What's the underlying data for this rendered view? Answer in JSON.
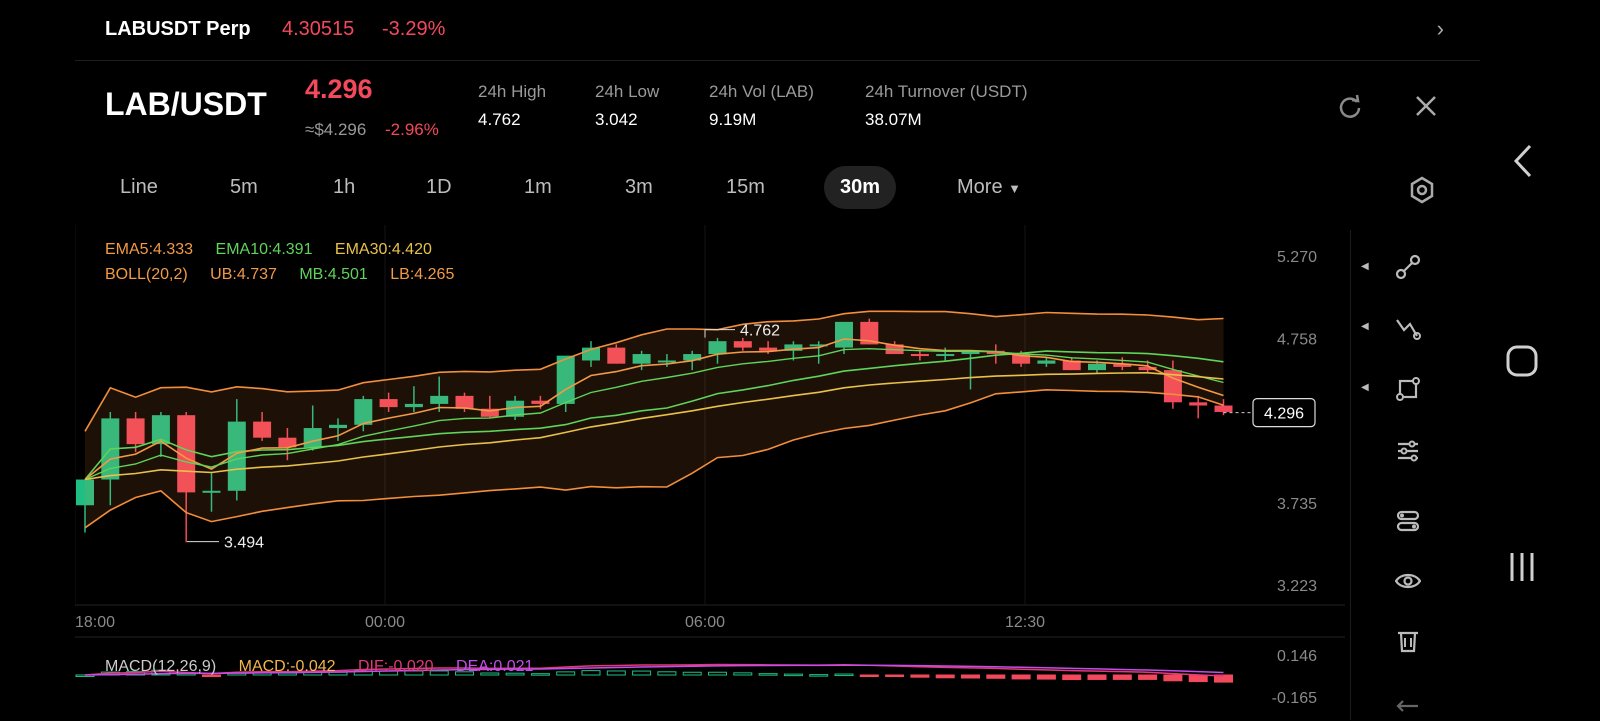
{
  "perp": {
    "name": "LABUSDT Perp",
    "price": "4.30515",
    "change": "-3.29%"
  },
  "header": {
    "pair": "LAB/USDT",
    "last_price": "4.296",
    "approx": "≈$4.296",
    "change": "-2.96%",
    "stats": [
      {
        "label": "24h  High",
        "value": "4.762"
      },
      {
        "label": "24h  Low",
        "value": "3.042"
      },
      {
        "label": "24h  Vol (LAB)",
        "value": "9.19M"
      },
      {
        "label": "24h  Turnover (USDT)",
        "value": "38.07M"
      }
    ]
  },
  "tabs": [
    "Line",
    "5m",
    "1h",
    "1D",
    "1m",
    "3m",
    "15m",
    "30m"
  ],
  "active_tab": "30m",
  "more_label": "More",
  "indicators": {
    "ema5": "EMA5:4.333",
    "ema10": "EMA10:4.391",
    "ema30": "EMA30:4.420",
    "boll": "BOLL(20,2)",
    "ub": "UB:4.737",
    "mb": "MB:4.501",
    "lb": "LB:4.265",
    "macd_name": "MACD(12,26,9)",
    "macd": "MACD:-0.042",
    "dif": "DIF:-0.020",
    "dea": "DEA:0.021"
  },
  "colors": {
    "up": "#1fbf83",
    "down": "#f2495c",
    "ema5": "#f29a45",
    "ema10": "#5fd35a",
    "ema30": "#e8c14a",
    "boll": "#f28e3c",
    "dea": "#c44ee8",
    "dif": "#e03a7a"
  },
  "chart_data": {
    "type": "candlestick",
    "y_ticks": [
      "5.270",
      "4.758",
      "3.735",
      "3.223"
    ],
    "x_ticks": [
      "18:00",
      "00:00",
      "06:00",
      "12:30"
    ],
    "current_price": "4.296",
    "high_marker": "4.762",
    "low_marker": "3.494",
    "macd_ticks": [
      "0.146",
      "-0.165"
    ],
    "ylim": [
      3.223,
      5.27
    ],
    "candles": [
      {
        "o": 3.72,
        "h": 3.84,
        "l": 3.55,
        "c": 3.88
      },
      {
        "o": 3.88,
        "h": 4.3,
        "l": 3.72,
        "c": 4.26
      },
      {
        "o": 4.26,
        "h": 4.3,
        "l": 4.05,
        "c": 4.1
      },
      {
        "o": 4.1,
        "h": 4.3,
        "l": 4.02,
        "c": 4.28
      },
      {
        "o": 4.28,
        "h": 4.3,
        "l": 3.49,
        "c": 3.8
      },
      {
        "o": 3.8,
        "h": 3.92,
        "l": 3.68,
        "c": 3.81
      },
      {
        "o": 3.81,
        "h": 4.38,
        "l": 3.75,
        "c": 4.24
      },
      {
        "o": 4.24,
        "h": 4.3,
        "l": 4.12,
        "c": 4.14
      },
      {
        "o": 4.14,
        "h": 4.2,
        "l": 4.0,
        "c": 4.08
      },
      {
        "o": 4.08,
        "h": 4.34,
        "l": 4.06,
        "c": 4.2
      },
      {
        "o": 4.2,
        "h": 4.26,
        "l": 4.12,
        "c": 4.22
      },
      {
        "o": 4.22,
        "h": 4.4,
        "l": 4.18,
        "c": 4.38
      },
      {
        "o": 4.38,
        "h": 4.42,
        "l": 4.3,
        "c": 4.33
      },
      {
        "o": 4.33,
        "h": 4.46,
        "l": 4.3,
        "c": 4.35
      },
      {
        "o": 4.35,
        "h": 4.52,
        "l": 4.3,
        "c": 4.4
      },
      {
        "o": 4.4,
        "h": 4.42,
        "l": 4.3,
        "c": 4.32
      },
      {
        "o": 4.32,
        "h": 4.4,
        "l": 4.26,
        "c": 4.27
      },
      {
        "o": 4.27,
        "h": 4.4,
        "l": 4.25,
        "c": 4.37
      },
      {
        "o": 4.37,
        "h": 4.4,
        "l": 4.32,
        "c": 4.35
      },
      {
        "o": 4.35,
        "h": 4.4,
        "l": 4.3,
        "c": 4.65
      },
      {
        "o": 4.62,
        "h": 4.74,
        "l": 4.58,
        "c": 4.7
      },
      {
        "o": 4.7,
        "h": 4.72,
        "l": 4.6,
        "c": 4.6
      },
      {
        "o": 4.6,
        "h": 4.68,
        "l": 4.56,
        "c": 4.66
      },
      {
        "o": 4.62,
        "h": 4.66,
        "l": 4.58,
        "c": 4.62
      },
      {
        "o": 4.62,
        "h": 4.68,
        "l": 4.56,
        "c": 4.66
      },
      {
        "o": 4.66,
        "h": 4.76,
        "l": 4.6,
        "c": 4.74
      },
      {
        "o": 4.74,
        "h": 4.76,
        "l": 4.68,
        "c": 4.7
      },
      {
        "o": 4.7,
        "h": 4.74,
        "l": 4.66,
        "c": 4.68
      },
      {
        "o": 4.68,
        "h": 4.74,
        "l": 4.62,
        "c": 4.72
      },
      {
        "o": 4.72,
        "h": 4.74,
        "l": 4.6,
        "c": 4.72
      },
      {
        "o": 4.7,
        "h": 4.76,
        "l": 4.66,
        "c": 4.86
      },
      {
        "o": 4.86,
        "h": 4.88,
        "l": 4.72,
        "c": 4.72
      },
      {
        "o": 4.72,
        "h": 4.74,
        "l": 4.66,
        "c": 4.66
      },
      {
        "o": 4.66,
        "h": 4.68,
        "l": 4.62,
        "c": 4.65
      },
      {
        "o": 4.65,
        "h": 4.7,
        "l": 4.62,
        "c": 4.66
      },
      {
        "o": 4.66,
        "h": 4.68,
        "l": 4.44,
        "c": 4.68
      },
      {
        "o": 4.68,
        "h": 4.72,
        "l": 4.6,
        "c": 4.66
      },
      {
        "o": 4.66,
        "h": 4.68,
        "l": 4.58,
        "c": 4.6
      },
      {
        "o": 4.6,
        "h": 4.64,
        "l": 4.58,
        "c": 4.62
      },
      {
        "o": 4.62,
        "h": 4.64,
        "l": 4.56,
        "c": 4.56
      },
      {
        "o": 4.56,
        "h": 4.62,
        "l": 4.54,
        "c": 4.6
      },
      {
        "o": 4.6,
        "h": 4.64,
        "l": 4.56,
        "c": 4.58
      },
      {
        "o": 4.58,
        "h": 4.62,
        "l": 4.54,
        "c": 4.56
      },
      {
        "o": 4.56,
        "h": 4.62,
        "l": 4.32,
        "c": 4.36
      },
      {
        "o": 4.36,
        "h": 4.4,
        "l": 4.26,
        "c": 4.34
      },
      {
        "o": 4.34,
        "h": 4.38,
        "l": 4.28,
        "c": 4.3
      }
    ]
  }
}
